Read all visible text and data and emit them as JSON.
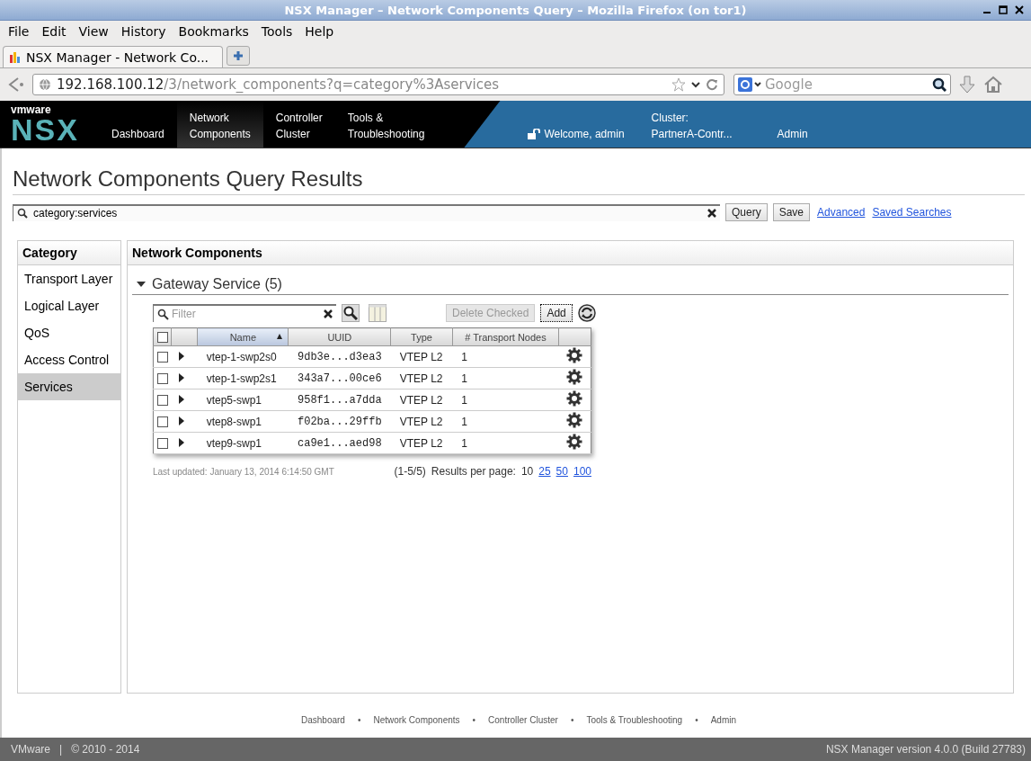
{
  "window": {
    "title": "NSX Manager – Network Components Query – Mozilla Firefox (on tor1)"
  },
  "menu": [
    "File",
    "Edit",
    "View",
    "History",
    "Bookmarks",
    "Tools",
    "Help"
  ],
  "browser_tab": {
    "title": "NSX Manager - Network Co...",
    "selected": true
  },
  "address": {
    "host": "192.168.100.12",
    "path": "/3/network_components?q=category%3Aservices"
  },
  "web_search": {
    "placeholder": "Google"
  },
  "app_header": {
    "logo_top": "vmware",
    "logo": "NSX",
    "nav": [
      {
        "label": "Dashboard",
        "selected": false
      },
      {
        "label": "Network\nComponents",
        "selected": true
      },
      {
        "label": "Controller\nCluster",
        "selected": false
      },
      {
        "label": "Tools &\nTroubleshooting",
        "selected": false
      }
    ],
    "welcome": "Welcome, admin",
    "cluster_label": "Cluster:",
    "cluster": "PartnerA-Contr...",
    "admin": "Admin"
  },
  "page_title": "Network Components Query Results",
  "query": {
    "value": "category:services",
    "buttons": [
      "Query",
      "Save"
    ],
    "links": [
      "Advanced",
      "Saved Searches"
    ]
  },
  "sidebar": {
    "title": "Category",
    "items": [
      {
        "label": "Transport Layer",
        "selected": false
      },
      {
        "label": "Logical Layer",
        "selected": false
      },
      {
        "label": "QoS",
        "selected": false
      },
      {
        "label": "Access Control",
        "selected": false
      },
      {
        "label": "Services",
        "selected": true
      }
    ]
  },
  "panel": {
    "title": "Network Components",
    "section": {
      "title": "Gateway Service (5)",
      "expanded": true
    },
    "filter": {
      "placeholder": "Filter"
    },
    "delete_button": {
      "label": "Delete Checked",
      "disabled": true
    },
    "add_button": "Add",
    "table": {
      "select_all": false,
      "columns": [
        {
          "label": "Name",
          "sorted": true
        },
        {
          "label": "UUID",
          "sorted": false
        },
        {
          "label": "Type",
          "sorted": false
        },
        {
          "label": "# Transport Nodes",
          "sorted": false
        }
      ],
      "rows": [
        {
          "checked": false,
          "name": "vtep-1-swp2s0",
          "uuid": "9db3e...d3ea3",
          "type": "VTEP L2",
          "nodes": "1"
        },
        {
          "checked": false,
          "name": "vtep-1-swp2s1",
          "uuid": "343a7...00ce6",
          "type": "VTEP L2",
          "nodes": "1"
        },
        {
          "checked": false,
          "name": "vtep5-swp1",
          "uuid": "958f1...a7dda",
          "type": "VTEP L2",
          "nodes": "1"
        },
        {
          "checked": false,
          "name": "vtep8-swp1",
          "uuid": "f02ba...29ffb",
          "type": "VTEP L2",
          "nodes": "1"
        },
        {
          "checked": false,
          "name": "vtep9-swp1",
          "uuid": "ca9e1...aed98",
          "type": "VTEP L2",
          "nodes": "1"
        }
      ]
    },
    "last_updated": "Last updated: January 13, 2014 6:14:50 GMT",
    "range": "(1-5/5)",
    "per_page_label": "Results per page:",
    "per_page": [
      {
        "label": "10",
        "selected": true
      },
      {
        "label": "25",
        "selected": false
      },
      {
        "label": "50",
        "selected": false
      },
      {
        "label": "100",
        "selected": false
      }
    ]
  },
  "footer_links": [
    "Dashboard",
    "Network Components",
    "Controller Cluster",
    "Tools & Troubleshooting",
    "Admin"
  ],
  "footer_separator": "•",
  "status": {
    "company": "VMware",
    "divider": "|",
    "copyright": "© 2010 - 2014",
    "version": "NSX Manager version 4.0.0 (Build 27783)"
  }
}
